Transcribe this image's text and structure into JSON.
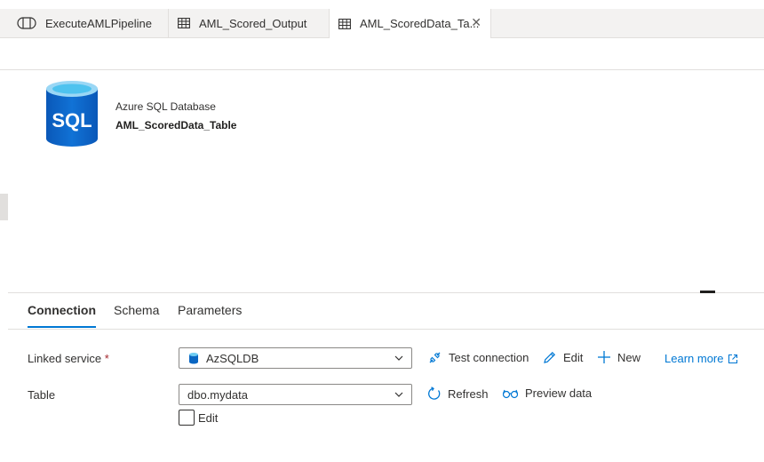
{
  "tabs": [
    {
      "label": "ExecuteAMLPipeline",
      "icon": "pipeline-icon"
    },
    {
      "label": "AML_Scored_Output",
      "icon": "table-icon"
    },
    {
      "label": "AML_ScoredData_Ta...",
      "icon": "table-icon",
      "active": true,
      "close": "✕"
    }
  ],
  "dataset": {
    "icon_text": "SQL",
    "type": "Azure SQL Database",
    "name": "AML_ScoredData_Table"
  },
  "panel_tabs": [
    "Connection",
    "Schema",
    "Parameters"
  ],
  "fields": {
    "linked_service": {
      "label": "Linked service",
      "required_mark": "*",
      "value": "AzSQLDB",
      "actions": {
        "test": "Test connection",
        "edit": "Edit",
        "new": "New"
      },
      "learn_more": "Learn more"
    },
    "table": {
      "label": "Table",
      "value": "dbo.mydata",
      "actions": {
        "refresh": "Refresh",
        "preview": "Preview data"
      },
      "edit_checkbox_label": "Edit",
      "edit_checked": false
    }
  },
  "colors": {
    "accent": "#0078d4",
    "required": "#a4262c",
    "sql_icon": "#0a66c2"
  }
}
